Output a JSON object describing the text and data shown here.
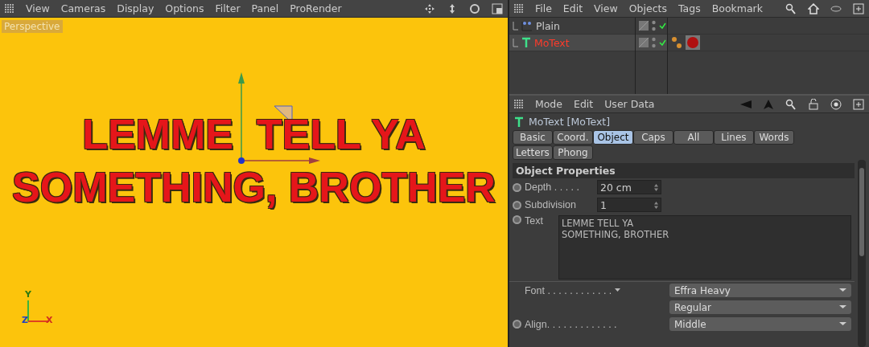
{
  "viewport": {
    "menu": [
      "View",
      "Cameras",
      "Display",
      "Options",
      "Filter",
      "Panel",
      "ProRender"
    ],
    "camera_label": "Perspective",
    "text_lines": [
      "LEMME  TELL YA",
      "SOMETHING, BROTHER"
    ],
    "axis_labels": [
      "Y",
      "Z",
      "X"
    ]
  },
  "object_manager": {
    "menu": [
      "File",
      "Edit",
      "View",
      "Objects",
      "Tags",
      "Bookmark"
    ],
    "objects": [
      {
        "name": "Plain",
        "kind": "null",
        "selected": false,
        "has_material": false
      },
      {
        "name": "MoText",
        "kind": "text",
        "selected": true,
        "has_material": true
      }
    ]
  },
  "attributes": {
    "menu": [
      "Mode",
      "Edit",
      "User Data"
    ],
    "title": "MoText [MoText]",
    "tabs": [
      {
        "label": "Basic",
        "selected": false
      },
      {
        "label": "Coord.",
        "selected": false
      },
      {
        "label": "Object",
        "selected": true
      },
      {
        "label": "Caps",
        "selected": false
      },
      {
        "label": "All",
        "selected": false
      },
      {
        "label": "Lines",
        "selected": false
      },
      {
        "label": "Words",
        "selected": false
      },
      {
        "label": "Letters",
        "selected": false
      },
      {
        "label": "Phong",
        "selected": false
      }
    ],
    "section": "Object Properties",
    "fields": [
      {
        "kind": "spinner",
        "label": "Depth . . . . .",
        "value": "20 cm",
        "animatable": true
      },
      {
        "kind": "spinner",
        "label": "Subdivision",
        "value": "1",
        "animatable": true
      },
      {
        "kind": "textarea",
        "label": "Text",
        "lines": [
          "LEMME TELL YA",
          "SOMETHING, BROTHER"
        ],
        "animatable": true
      },
      {
        "kind": "dropdown",
        "label": "Font . . . . . . . . . . . .",
        "value": "Effra Heavy",
        "animatable": false,
        "has_arrow": true
      },
      {
        "kind": "dropdown",
        "value": "Regular",
        "animatable": false
      },
      {
        "kind": "dropdown",
        "label": "Align. . . . . . . . . . . . .",
        "value": "Middle",
        "animatable": true
      }
    ]
  }
}
